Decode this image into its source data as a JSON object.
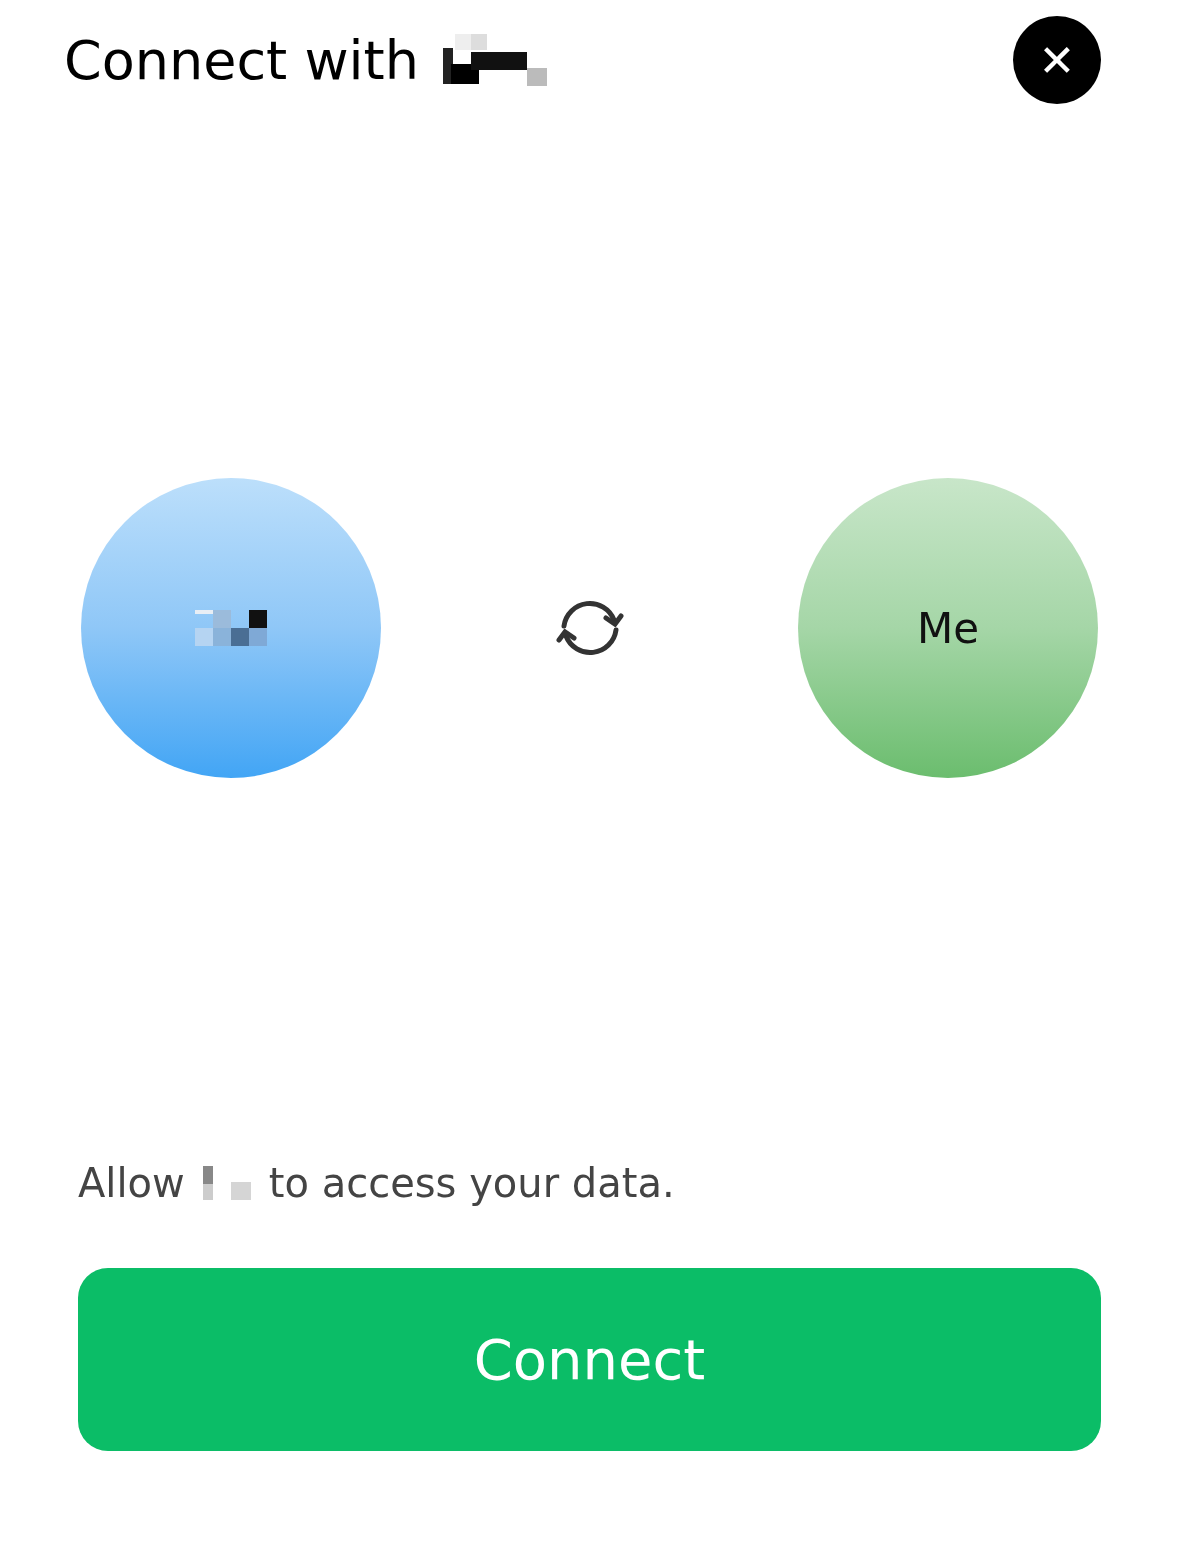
{
  "header": {
    "title": "Connect with",
    "close": "✕"
  },
  "parties": [
    {
      "kind": "app"
    },
    {
      "label": "Me",
      "kind": "user"
    }
  ],
  "consent": {
    "before": "Allow",
    "after": "to access your data."
  },
  "button": {
    "label": "Connect"
  }
}
